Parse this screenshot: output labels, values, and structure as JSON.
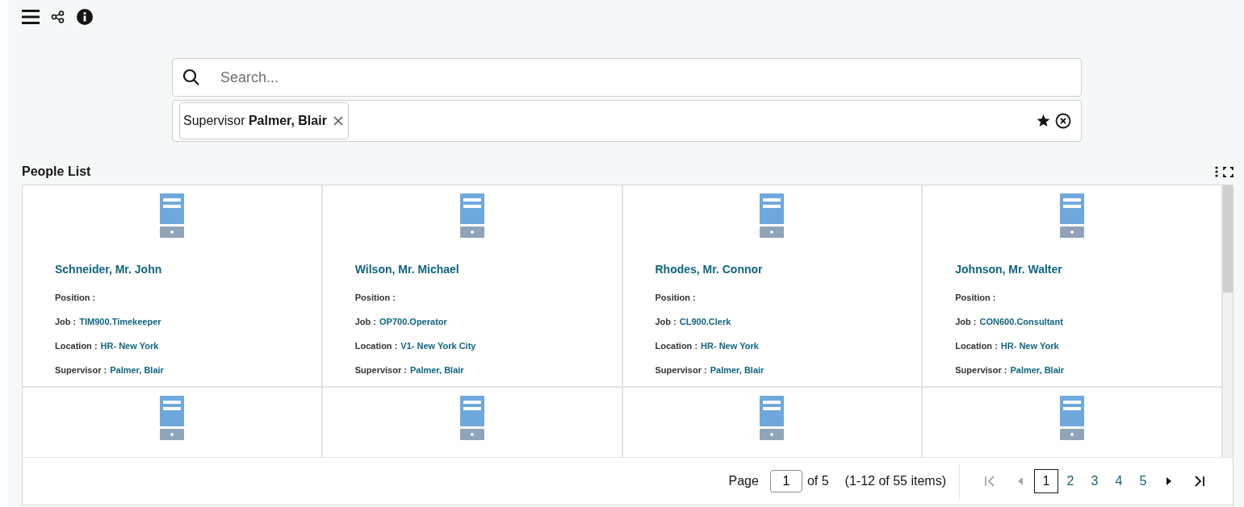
{
  "search": {
    "placeholder": "Search..."
  },
  "filters": [
    {
      "label": "Supervisor",
      "value": "Palmer, Blair"
    }
  ],
  "list": {
    "title": "People List",
    "cards": [
      {
        "kind": "full",
        "name": "Schneider, Mr. John",
        "fields": [
          {
            "label": "Position :"
          },
          {
            "label": "Job :",
            "value": "TIM900.Timekeeper"
          },
          {
            "label": "Location :",
            "value": "HR- New York"
          },
          {
            "label": "Supervisor :",
            "value": "Palmer, Blair"
          }
        ]
      },
      {
        "kind": "full",
        "name": "Wilson, Mr. Michael",
        "fields": [
          {
            "label": "Position :"
          },
          {
            "label": "Job :",
            "value": "OP700.Operator"
          },
          {
            "label": "Location :",
            "value": "V1- New York City"
          },
          {
            "label": "Supervisor :",
            "value": "Palmer, Blair"
          }
        ]
      },
      {
        "kind": "full",
        "name": "Rhodes, Mr. Connor",
        "fields": [
          {
            "label": "Position :"
          },
          {
            "label": "Job :",
            "value": "CL900.Clerk"
          },
          {
            "label": "Location :",
            "value": "HR- New York"
          },
          {
            "label": "Supervisor :",
            "value": "Palmer, Blair"
          }
        ]
      },
      {
        "kind": "full",
        "name": "Johnson, Mr. Walter",
        "fields": [
          {
            "label": "Position :"
          },
          {
            "label": "Job :",
            "value": "CON600.Consultant"
          },
          {
            "label": "Location :",
            "value": "HR- New York"
          },
          {
            "label": "Supervisor :",
            "value": "Palmer, Blair"
          }
        ]
      },
      {
        "kind": "cut"
      },
      {
        "kind": "cut"
      },
      {
        "kind": "cut"
      },
      {
        "kind": "cut"
      }
    ]
  },
  "pagination": {
    "page_label": "Page",
    "page_value": "1",
    "of_label": "of 5",
    "range": "(1-12 of 55 items)",
    "first_disabled": true,
    "prev_disabled": true,
    "next_disabled": false,
    "last_disabled": false,
    "pages": [
      {
        "label": "1",
        "selected": true
      },
      {
        "label": "2",
        "selected": false
      },
      {
        "label": "3",
        "selected": false
      },
      {
        "label": "4",
        "selected": false
      },
      {
        "label": "5",
        "selected": false
      }
    ]
  }
}
